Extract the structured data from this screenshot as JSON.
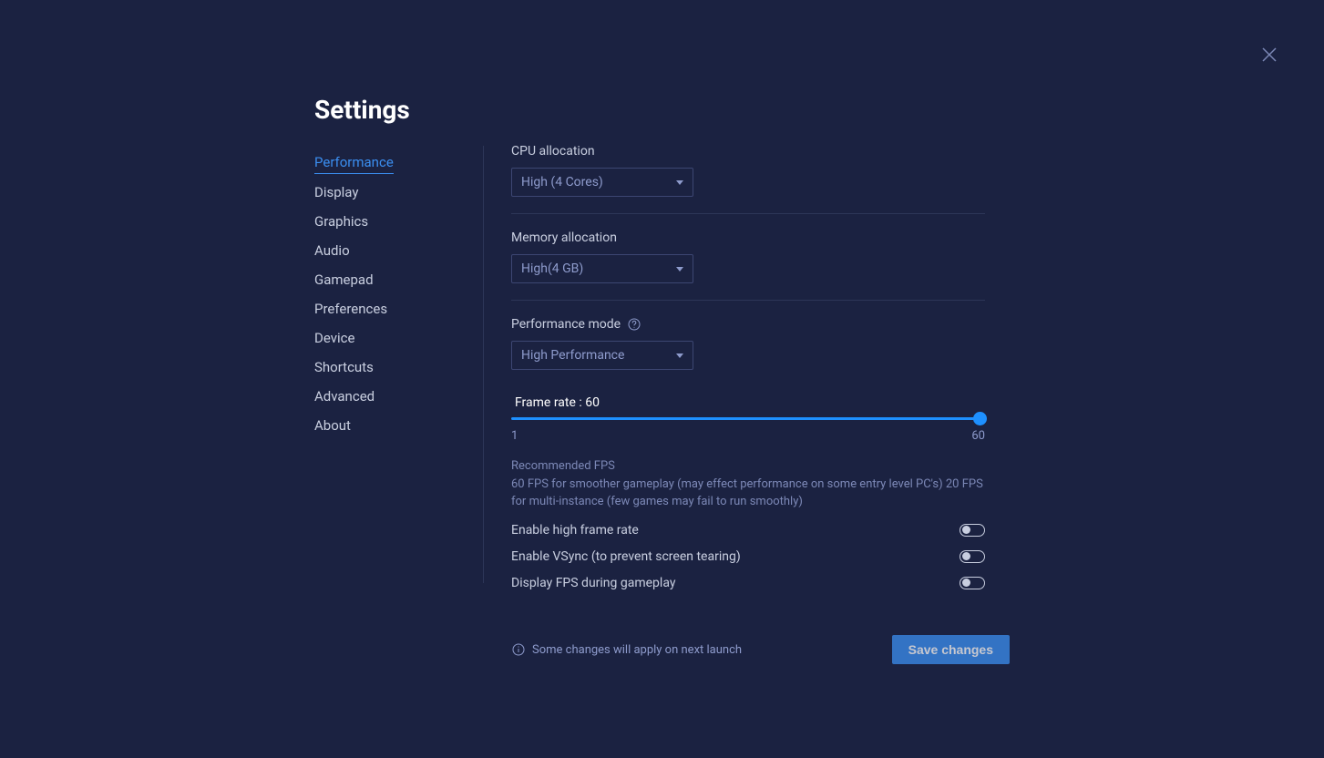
{
  "page_title": "Settings",
  "sidebar": {
    "items": [
      {
        "label": "Performance",
        "active": true
      },
      {
        "label": "Display"
      },
      {
        "label": "Graphics"
      },
      {
        "label": "Audio"
      },
      {
        "label": "Gamepad"
      },
      {
        "label": "Preferences"
      },
      {
        "label": "Device"
      },
      {
        "label": "Shortcuts"
      },
      {
        "label": "Advanced"
      },
      {
        "label": "About"
      }
    ]
  },
  "main": {
    "cpu": {
      "label": "CPU allocation",
      "value": "High (4 Cores)"
    },
    "memory": {
      "label": "Memory allocation",
      "value": "High(4 GB)"
    },
    "mode": {
      "label": "Performance mode",
      "value": "High Performance"
    },
    "fps": {
      "label_text": "Frame rate : 60",
      "min": "1",
      "max": "60",
      "value": 60,
      "note_title": "Recommended FPS",
      "note_body": "60 FPS for smoother gameplay (may effect performance on some entry level PC's) 20 FPS for multi-instance (few games may fail to run smoothly)"
    },
    "toggles": {
      "high_frame": {
        "label": "Enable high frame rate",
        "on": false
      },
      "vsync": {
        "label": "Enable VSync (to prevent screen tearing)",
        "on": false
      },
      "display_fps": {
        "label": "Display FPS during gameplay",
        "on": false
      }
    }
  },
  "footer": {
    "restart_note": "Some changes will apply on next launch",
    "save_label": "Save changes"
  }
}
